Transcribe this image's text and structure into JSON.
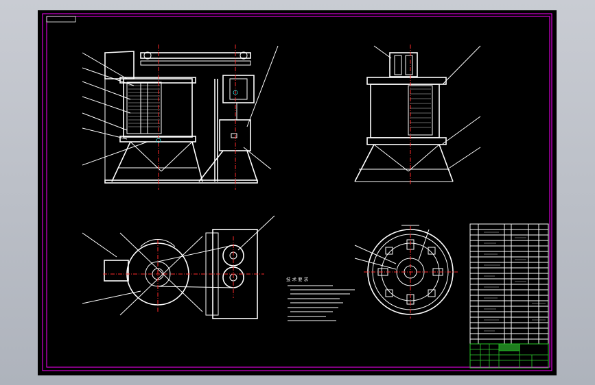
{
  "sheet": {
    "background": "#000000",
    "frame_color": "#ff00ff",
    "line_color": "#ffffff",
    "centerline_color": "#ff2a2a",
    "title_block_color": "#27c827"
  },
  "tech_requirements": {
    "heading": "技 术 要 求"
  }
}
